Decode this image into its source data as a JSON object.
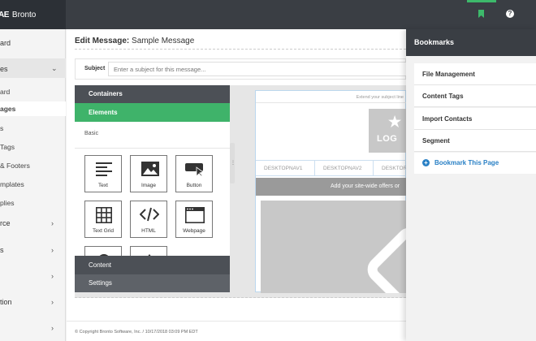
{
  "app": {
    "logo_mark": "AE",
    "logo_text": "Bronto"
  },
  "sidebar": {
    "items": [
      {
        "label": "ard"
      },
      {
        "label": "es"
      },
      {
        "label": "rce"
      },
      {
        "label": "s"
      },
      {
        "label": ""
      },
      {
        "label": "tion"
      },
      {
        "label": ""
      }
    ],
    "subitems": [
      {
        "label": "ard"
      },
      {
        "label": "ages"
      },
      {
        "label": "s"
      },
      {
        "label": "Tags"
      },
      {
        "label": "& Footers"
      },
      {
        "label": "mplates"
      },
      {
        "label": "plies"
      }
    ]
  },
  "editor": {
    "title_label": "Edit Message:",
    "title_value": "Sample Message",
    "subject_label": "Subject",
    "subject_placeholder": "Enter a subject for this message...",
    "palette": {
      "containers": "Containers",
      "elements": "Elements",
      "basic": "Basic",
      "content": "Content",
      "settings": "Settings",
      "tiles": [
        {
          "label": "Text",
          "icon": "text-icon"
        },
        {
          "label": "Image",
          "icon": "image-icon"
        },
        {
          "label": "Button",
          "icon": "button-icon"
        },
        {
          "label": "Text Grid",
          "icon": "grid-icon"
        },
        {
          "label": "HTML",
          "icon": "html-icon"
        },
        {
          "label": "Webpage",
          "icon": "webpage-icon"
        }
      ]
    },
    "canvas": {
      "extend_text": "Extend your subject line",
      "logo_text": "LOG",
      "nav": [
        "DESKTOPNAV1",
        "DESKTOPNAV2",
        "DESKTOR"
      ],
      "offers_text": "Add your site-wide offers or"
    },
    "copyright": "© Copyright Bronto Software, Inc.  /  10/17/2018 03:09 PM EDT"
  },
  "bookmarks": {
    "title": "Bookmarks",
    "items": [
      "File Management",
      "Content Tags",
      "Import Contacts",
      "Segment"
    ],
    "add_label": "Bookmark This Page"
  },
  "colors": {
    "accent_green": "#3db96b",
    "topbar": "#3a3e44",
    "link_blue": "#2980c5"
  }
}
